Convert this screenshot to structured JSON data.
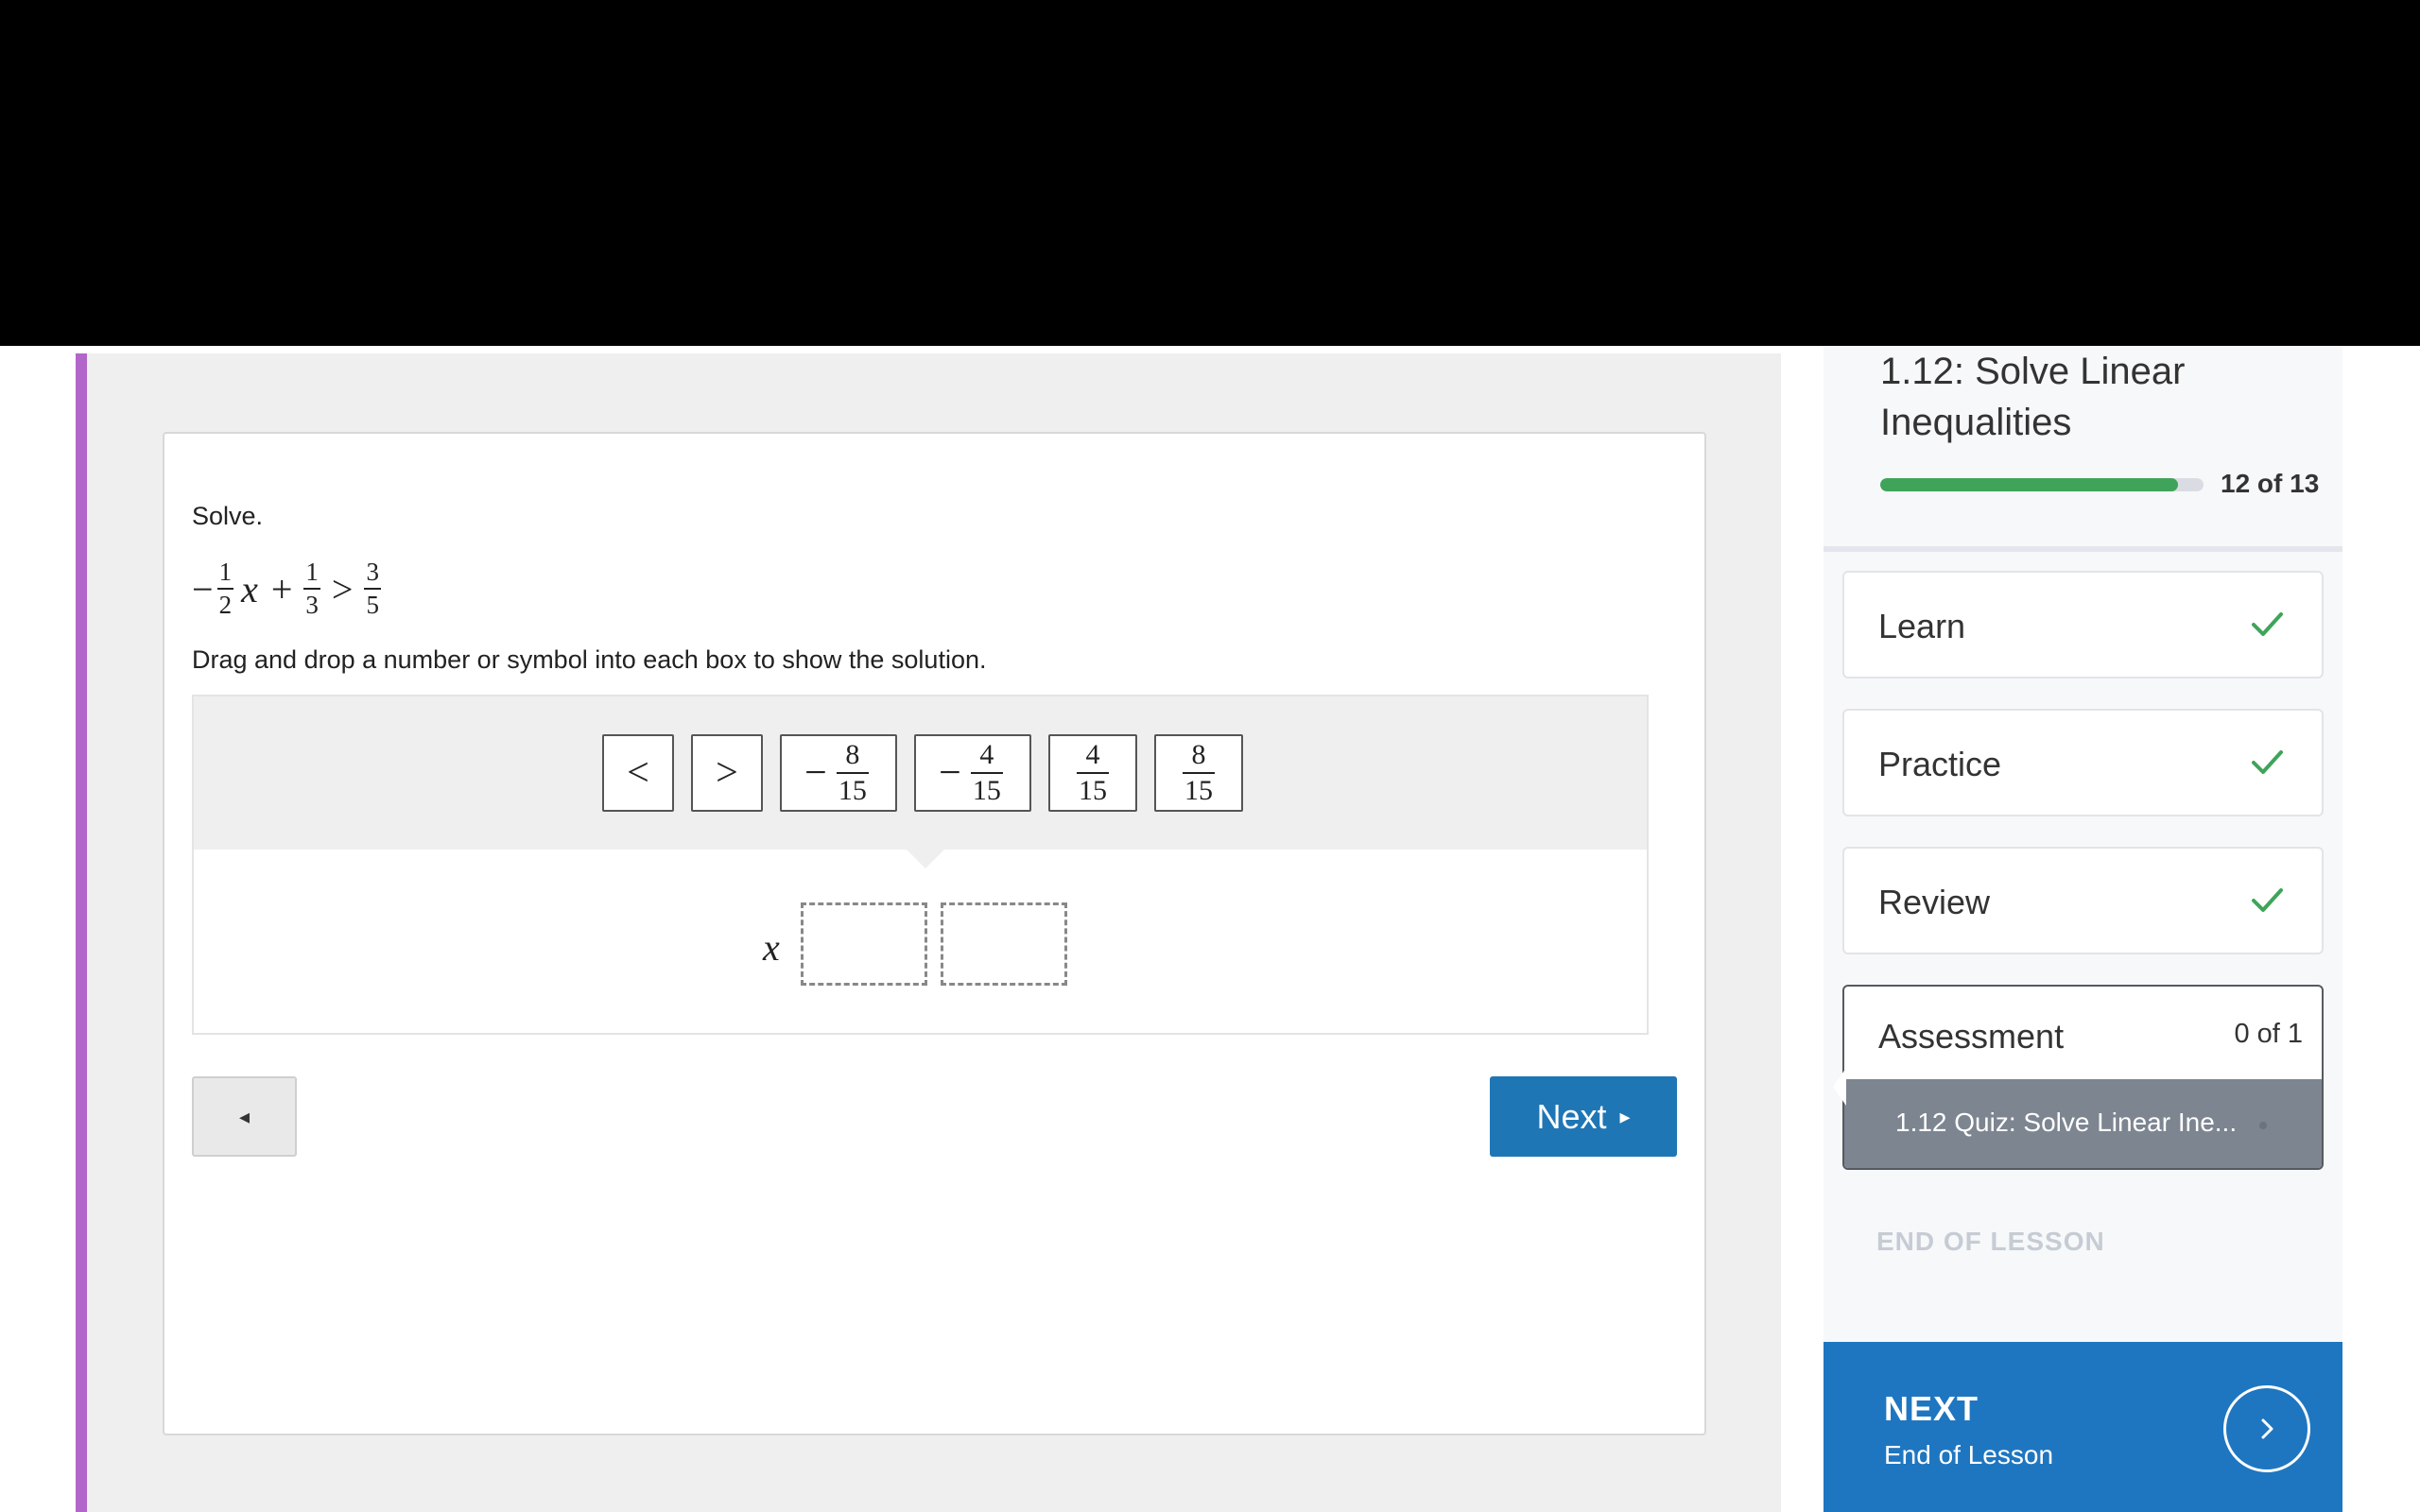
{
  "question": {
    "instruction": "Solve.",
    "equation": {
      "neg_sign": "−",
      "frac1": {
        "num": "1",
        "den": "2"
      },
      "variable": "x",
      "plus": "+",
      "frac2": {
        "num": "1",
        "den": "3"
      },
      "relation": ">",
      "frac3": {
        "num": "3",
        "den": "5"
      }
    },
    "prompt": "Drag and drop a number or symbol into each box to show the solution."
  },
  "tokens": {
    "lt": "<",
    "gt": ">",
    "neg_8_15": {
      "sign": "−",
      "num": "8",
      "den": "15"
    },
    "neg_4_15": {
      "sign": "−",
      "num": "4",
      "den": "15"
    },
    "pos_4_15": {
      "num": "4",
      "den": "15"
    },
    "pos_8_15": {
      "num": "8",
      "den": "15"
    }
  },
  "answer": {
    "variable": "x"
  },
  "nav": {
    "back_icon": "◂",
    "next_label": "Next",
    "next_icon": "▸"
  },
  "sidebar": {
    "lesson_title": "1.12: Solve Linear Inequalities",
    "progress": {
      "current": 12,
      "total": 13,
      "text": "12 of 13",
      "fraction": 0.92
    },
    "items": [
      {
        "label": "Learn",
        "status": "complete"
      },
      {
        "label": "Practice",
        "status": "complete"
      },
      {
        "label": "Review",
        "status": "complete"
      }
    ],
    "assessment": {
      "label": "Assessment",
      "count": "0 of 1",
      "quiz_label": "1.12 Quiz: Solve Linear Ine..."
    },
    "end_label": "END OF LESSON",
    "next": {
      "title": "NEXT",
      "subtitle": "End of Lesson"
    }
  },
  "colors": {
    "accent_purple": "#b266c9",
    "button_blue": "#1f76b5",
    "progress_green": "#3fa45a",
    "check_green": "#3fa45a",
    "quiz_gray": "#7d8590",
    "next_panel_blue": "#1f76c0"
  },
  "icons": {
    "check": "check-icon",
    "chevron_right": "chevron-right-icon",
    "back": "back-arrow-icon",
    "next": "next-arrow-icon"
  }
}
